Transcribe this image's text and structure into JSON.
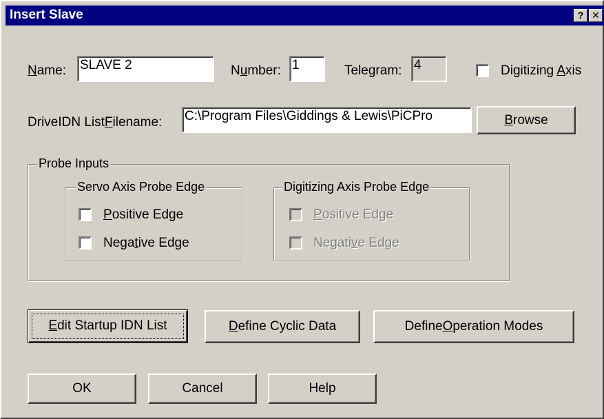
{
  "window": {
    "title": "Insert Slave",
    "help_glyph": "?",
    "close_glyph": "✕"
  },
  "name": {
    "label_u": "N",
    "label_rest": "ame:",
    "value": "SLAVE 2"
  },
  "number": {
    "label_a": "N",
    "label_u": "u",
    "label_rest": "mber:",
    "value": "1"
  },
  "telegram": {
    "label": "Telegram:",
    "value": "4"
  },
  "digitizing_axis": {
    "label_a": "Digitizing ",
    "label_u": "A",
    "label_rest": "xis",
    "checked": false
  },
  "drive_idn": {
    "label_a": "DriveIDN List",
    "label_u": "F",
    "label_rest": "ilename:",
    "value": "C:\\Program Files\\Giddings & Lewis\\PiCPro",
    "browse_u": "B",
    "browse_rest": "rowse"
  },
  "probe_inputs": {
    "title": "Probe Inputs",
    "servo": {
      "title": "Servo Axis Probe Edge",
      "positive_u": "P",
      "positive_rest": "ositive Edge",
      "negative_a": "Nega",
      "negative_u": "t",
      "negative_rest": "ive Edge"
    },
    "digitizing": {
      "title": "Digitizing Axis Probe Edge",
      "positive_u": "P",
      "positive_rest": "ositive Edge",
      "negative_a": "Negati",
      "negative_u": "v",
      "negative_rest": "e Edge"
    }
  },
  "buttons": {
    "edit_startup_u": "E",
    "edit_startup_rest": "dit Startup IDN List",
    "define_cyclic_u": "D",
    "define_cyclic_rest": "efine Cyclic Data",
    "define_op_a": "Define ",
    "define_op_u": "O",
    "define_op_rest": "peration Modes",
    "ok": "OK",
    "cancel": "Cancel",
    "help": "Help"
  }
}
